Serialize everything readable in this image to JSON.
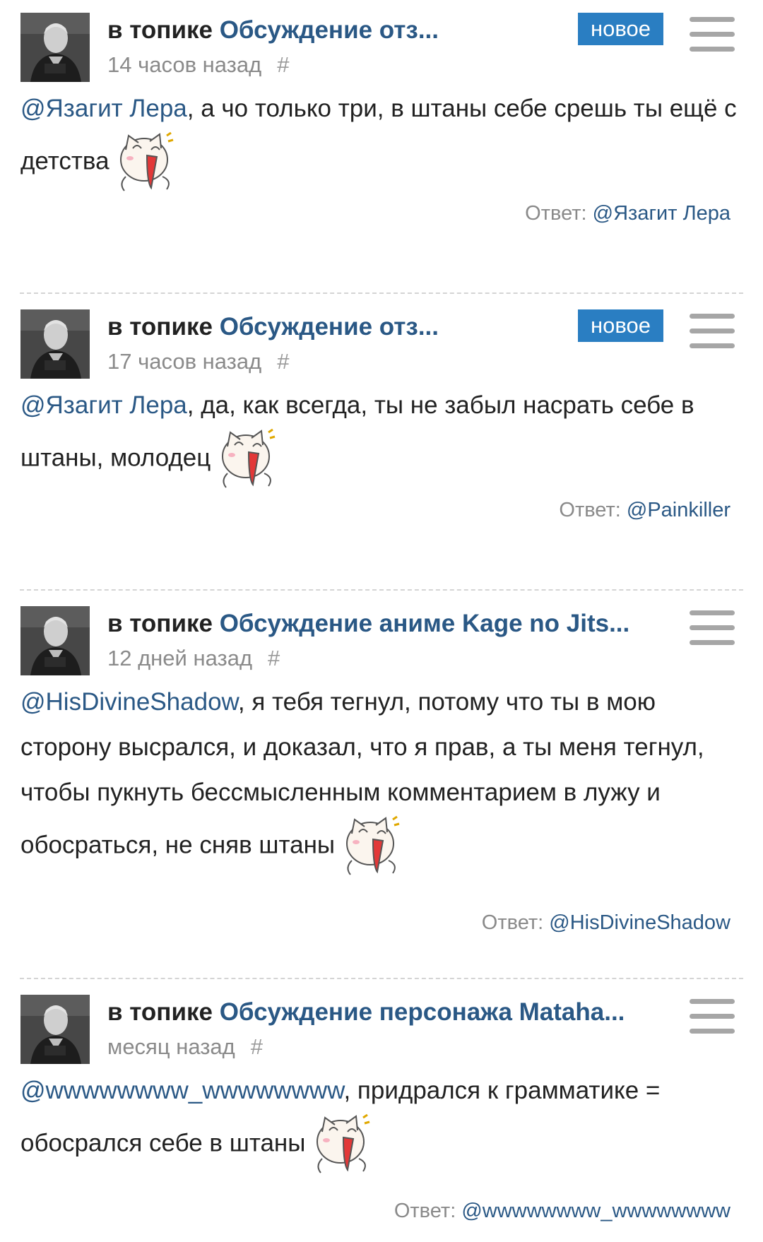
{
  "comments": [
    {
      "topic_prefix": "в топике",
      "topic_title": "Обсуждение отз...",
      "time": "14 часов назад",
      "hash": "#",
      "badge": "новое",
      "mention": "@Язагит Лера",
      "text": ", а чо только три, в штаны себе срешь ты ещё с детства",
      "reply_label": "Ответ:",
      "reply_to": "@Язагит Лера"
    },
    {
      "topic_prefix": "в топике",
      "topic_title": "Обсуждение отз...",
      "time": "17 часов назад",
      "hash": "#",
      "badge": "новое",
      "mention": "@Язагит Лера",
      "text": ", да, как всегда, ты не забыл насрать себе в штаны, молодец",
      "reply_label": "Ответ:",
      "reply_to": "@Painkiller"
    },
    {
      "topic_prefix": "в топике",
      "topic_title": "Обсуждение аниме Kage no Jits...",
      "time": "12 дней назад",
      "hash": "#",
      "mention": "@HisDivineShadow",
      "text": ", я тебя тегнул, потому что ты в мою сторону высрался, и доказал, что я прав, а ты меня тегнул, чтобы пукнуть бессмысленным комментарием в лужу и обосраться, не сняв штаны",
      "reply_label": "Ответ:",
      "reply_to": "@HisDivineShadow"
    },
    {
      "topic_prefix": "в топике",
      "topic_title": "Обсуждение персонажа Mataha...",
      "time": "месяц назад",
      "hash": "#",
      "mention": "@wwwwwwww_wwwwwwww",
      "text": ", придрался к грамматике = обосрался себе в штаны",
      "reply_label": "Ответ:",
      "reply_to": "@wwwwwwww_wwwwwwww"
    }
  ],
  "icons": {
    "menu": "hamburger-menu-icon",
    "sticker": "screaming-cat-sticker",
    "avatar": "user-avatar"
  },
  "colors": {
    "link": "#2a5885",
    "badge": "#2a7ec2",
    "muted": "#8a8a8a",
    "menu": "#a6a6a6"
  }
}
